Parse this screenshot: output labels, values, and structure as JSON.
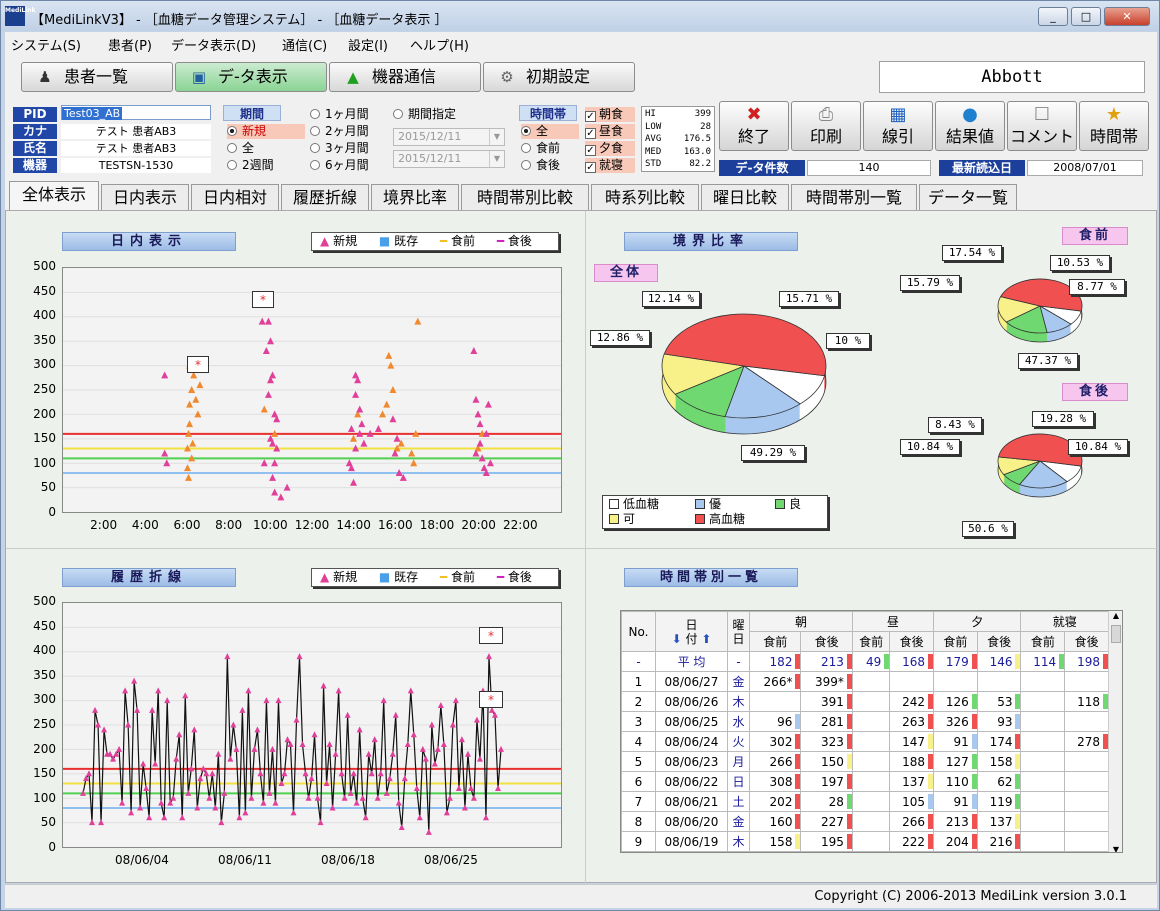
{
  "window": {
    "title": "【MediLinkV3】 - ［血糖データ管理システム］ - ［血糖データ表示 ］",
    "app_icon_text": "MediLink",
    "controls": {
      "minimize": "_",
      "maximize": "□",
      "close": "✕"
    }
  },
  "menu": [
    "システム(S)",
    "患者(P)",
    "データ表示(D)",
    "通信(C)",
    "設定(I)",
    "ヘルプ(H)"
  ],
  "toolbar": {
    "buttons": [
      {
        "label": "患者一覧",
        "icon": "people-icon"
      },
      {
        "label": "デ-タ表示",
        "icon": "window-icon"
      },
      {
        "label": "機器通信",
        "icon": "upload-icon"
      },
      {
        "label": "初期設定",
        "icon": "gear-icon"
      }
    ],
    "device": "Abbott"
  },
  "patient": {
    "labels": {
      "pid": "PID",
      "kana": "カナ",
      "name": "氏名",
      "device": "機器"
    },
    "pid": "Test03_AB",
    "kana": "テスト 患者AB3",
    "name": "テスト 患者AB3",
    "device": "TESTSN-1530"
  },
  "period": {
    "title": "期間",
    "options": [
      "新規",
      "全",
      "2週間",
      "1ヶ月間",
      "2ヶ月間",
      "3ヶ月間",
      "6ヶ月間",
      "期間指定"
    ],
    "selected": "新規",
    "date_from": "2015/12/11",
    "date_to": "2015/12/11"
  },
  "timeslot": {
    "title": "時間帯",
    "radios": [
      "全",
      "食前",
      "食後"
    ],
    "selected": "全",
    "checks": [
      "朝食",
      "昼食",
      "夕食",
      "就寝"
    ],
    "check_mark": "✓"
  },
  "stats": [
    {
      "k": "HI",
      "v": "399"
    },
    {
      "k": "LOW",
      "v": "28"
    },
    {
      "k": "AVG",
      "v": "176.5"
    },
    {
      "k": "MED",
      "v": "163.0"
    },
    {
      "k": "STD",
      "v": "82.2"
    }
  ],
  "actions": [
    {
      "label": "終了",
      "icon": "close-icon",
      "glyph": "✖",
      "color": "#d02020"
    },
    {
      "label": "印刷",
      "icon": "printer-icon",
      "glyph": "⎙",
      "color": "#888888"
    },
    {
      "label": "線引",
      "icon": "line-icon",
      "glyph": "▦",
      "color": "#2060c0"
    },
    {
      "label": "結果値",
      "icon": "pin-icon",
      "glyph": "●",
      "color": "#2080d0"
    },
    {
      "label": "コメント",
      "icon": "comment-icon",
      "glyph": "☐",
      "color": "#888888"
    },
    {
      "label": "時間帯",
      "icon": "star-icon",
      "glyph": "★",
      "color": "#e0a010"
    }
  ],
  "counts": {
    "data_label": "デ-タ件数",
    "data_value": "140",
    "last_label": "最新読込日",
    "last_value": "2008/07/01"
  },
  "tabs": [
    "全体表示",
    "日内表示",
    "日内相対",
    "履歴折線",
    "境界比率",
    "時間帯別比較",
    "時系列比較",
    "曜日比較",
    "時間帯別一覧",
    "データ一覧"
  ],
  "active_tab": "全体表示",
  "legend": {
    "new": "新規",
    "existing": "既存",
    "before": "食前",
    "after": "食後"
  },
  "colors": {
    "pink_point": "#e0409a",
    "orange_point": "#f08a30",
    "red_line": "#e83030",
    "yellow_line": "#f0e040",
    "green_line": "#50d050",
    "blue_line": "#90c0f0",
    "low": "#ffffff",
    "excellent": "#a8c8f0",
    "good": "#70d870",
    "fair": "#f8f088",
    "high": "#f05050"
  },
  "daily": {
    "title": "日内表示",
    "marker": "*",
    "yticks": [
      "500",
      "450",
      "400",
      "350",
      "300",
      "250",
      "200",
      "150",
      "100",
      "50",
      "0"
    ],
    "xticks": [
      "2:00",
      "4:00",
      "6:00",
      "8:00",
      "10:00",
      "12:00",
      "14:00",
      "16:00",
      "18:00",
      "20:00",
      "22:00"
    ]
  },
  "chart_data": [
    {
      "type": "scatter",
      "title": "日内表示",
      "x_unit": "hour of day",
      "ylim": [
        0,
        500
      ],
      "xlim": [
        0,
        24
      ],
      "reference_lines": [
        160,
        130,
        110,
        80
      ],
      "series": [
        {
          "name": "既存",
          "points": [
            [
              6,
              130
            ],
            [
              6.05,
              160
            ],
            [
              6.1,
              220
            ],
            [
              6.2,
              250
            ],
            [
              6.1,
              300
            ],
            [
              6.3,
              280
            ],
            [
              6,
              90
            ],
            [
              6.05,
              70
            ],
            [
              6.2,
              110
            ],
            [
              6.4,
              230
            ],
            [
              6.6,
              260
            ],
            [
              6.5,
              200
            ],
            [
              6.1,
              180
            ],
            [
              6.25,
              140
            ],
            [
              9.7,
              210
            ],
            [
              10.2,
              160
            ],
            [
              14,
              150
            ],
            [
              14.2,
              200
            ],
            [
              15.4,
              200
            ],
            [
              15.6,
              220
            ],
            [
              15.7,
              320
            ],
            [
              15.8,
              300
            ],
            [
              15.9,
              250
            ],
            [
              16.1,
              130
            ],
            [
              16.3,
              140
            ],
            [
              16.8,
              120
            ],
            [
              16.9,
              100
            ],
            [
              17,
              160
            ],
            [
              17.1,
              390
            ],
            [
              20,
              130
            ],
            [
              20.2,
              160
            ]
          ]
        },
        {
          "name": "新規",
          "points": [
            [
              4.9,
              280
            ],
            [
              4.9,
              120
            ],
            [
              5,
              100
            ],
            [
              9.6,
              390
            ],
            [
              9.8,
              330
            ],
            [
              9.9,
              390
            ],
            [
              10,
              350
            ],
            [
              10.1,
              280
            ],
            [
              10,
              270
            ],
            [
              10.2,
              200
            ],
            [
              10.3,
              190
            ],
            [
              10,
              150
            ],
            [
              10.1,
              140
            ],
            [
              10.3,
              130
            ],
            [
              10.2,
              100
            ],
            [
              10.1,
              70
            ],
            [
              10.2,
              40
            ],
            [
              10.5,
              30
            ],
            [
              10.8,
              50
            ],
            [
              9.7,
              100
            ],
            [
              9.9,
              240
            ],
            [
              13.8,
              100
            ],
            [
              13.9,
              90
            ],
            [
              14,
              60
            ],
            [
              14.1,
              130
            ],
            [
              14.3,
              160
            ],
            [
              14.4,
              180
            ],
            [
              14.1,
              240
            ],
            [
              14.2,
              270
            ],
            [
              14.1,
              280
            ],
            [
              14.3,
              210
            ],
            [
              14.5,
              140
            ],
            [
              13.9,
              170
            ],
            [
              14.8,
              160
            ],
            [
              15.2,
              170
            ],
            [
              15.9,
              190
            ],
            [
              16,
              120
            ],
            [
              16.2,
              80
            ],
            [
              16.4,
              70
            ],
            [
              16.1,
              150
            ],
            [
              19.8,
              330
            ],
            [
              19.9,
              230
            ],
            [
              20,
              200
            ],
            [
              20.1,
              180
            ],
            [
              20.2,
              110
            ],
            [
              20.3,
              90
            ],
            [
              20.5,
              220
            ],
            [
              20.4,
              160
            ],
            [
              20.1,
              140
            ],
            [
              19.9,
              120
            ],
            [
              20.6,
              100
            ],
            [
              20.4,
              80
            ]
          ]
        }
      ]
    },
    {
      "type": "pie",
      "title": "全体",
      "categories": [
        "低血糖",
        "優",
        "良",
        "可",
        "高血糖"
      ],
      "values": [
        10,
        15.71,
        12.14,
        12.86,
        49.29
      ]
    },
    {
      "type": "pie",
      "title": "食前",
      "categories": [
        "低血糖",
        "優",
        "良",
        "可",
        "高血糖"
      ],
      "values": [
        8.77,
        10.53,
        17.54,
        15.79,
        47.37
      ]
    },
    {
      "type": "pie",
      "title": "食後",
      "categories": [
        "低血糖",
        "優",
        "良",
        "可",
        "高血糖"
      ],
      "values": [
        10.84,
        19.28,
        8.43,
        10.84,
        50.6
      ]
    },
    {
      "type": "line",
      "title": "履歴折線",
      "ylim": [
        0,
        500
      ],
      "reference_lines": [
        160,
        130,
        110,
        80
      ],
      "x_ticks": [
        "08/06/04",
        "08/06/11",
        "08/06/18",
        "08/06/25"
      ],
      "values": [
        110,
        140,
        150,
        50,
        280,
        250,
        50,
        240,
        190,
        190,
        180,
        190,
        200,
        90,
        320,
        250,
        70,
        340,
        280,
        80,
        170,
        120,
        60,
        280,
        170,
        320,
        90,
        60,
        300,
        90,
        100,
        180,
        230,
        60,
        310,
        110,
        160,
        240,
        80,
        140,
        160,
        150,
        100,
        150,
        80,
        190,
        50,
        110,
        390,
        180,
        250,
        200,
        60,
        280,
        70,
        320,
        100,
        200,
        240,
        150,
        90,
        300,
        110,
        200,
        90,
        300,
        130,
        150,
        220,
        210,
        70,
        260,
        390,
        210,
        150,
        100,
        140,
        230,
        100,
        50,
        330,
        130,
        210,
        80,
        190,
        320,
        150,
        100,
        270,
        110,
        150,
        90,
        240,
        100,
        60,
        190,
        150,
        220,
        100,
        150,
        300,
        110,
        140,
        190,
        270,
        90,
        40,
        140,
        210,
        320,
        230,
        120,
        60,
        200,
        180,
        30,
        250,
        170,
        200,
        290,
        210,
        70,
        100,
        250,
        300,
        120,
        220,
        80,
        190,
        120,
        100,
        260,
        180,
        320,
        60,
        390,
        280,
        270,
        120,
        200
      ]
    }
  ],
  "history": {
    "title": "履歴折線",
    "yticks": [
      "500",
      "450",
      "400",
      "350",
      "300",
      "250",
      "200",
      "150",
      "100",
      "50",
      "0"
    ],
    "xticks": [
      "08/06/04",
      "08/06/11",
      "08/06/18",
      "08/06/25"
    ],
    "marker": "*"
  },
  "boundary": {
    "title": "境界比率",
    "total_title": "全体",
    "before_title": "食前",
    "after_title": "食後",
    "total_labels": [
      "10 %",
      "15.71 %",
      "12.14 %",
      "12.86 %",
      "49.29 %"
    ],
    "before_labels": [
      "8.77 %",
      "10.53 %",
      "17.54 %",
      "15.79 %",
      "47.37 %"
    ],
    "after_labels": [
      "10.84 %",
      "19.28 %",
      "8.43 %",
      "10.84 %",
      "50.6 %"
    ],
    "legend": [
      "低血糖",
      "優",
      "良",
      "可",
      "高血糖"
    ]
  },
  "timetable": {
    "title": "時間帯別一覧",
    "col_no": "No.",
    "col_date_top": "日",
    "col_date_bottom": "付",
    "col_dow_top": "曜",
    "col_dow_bottom": "日",
    "groups": [
      "朝",
      "昼",
      "夕",
      "就寝"
    ],
    "sub": [
      "食前",
      "食後"
    ],
    "avg": {
      "no": "-",
      "label": "平 均",
      "dow": "-",
      "vals": [
        "182",
        "213",
        "49",
        "168",
        "179",
        "146",
        "114",
        "198"
      ]
    },
    "rows": [
      {
        "no": "1",
        "date": "08/06/27",
        "dow": "金",
        "vals": [
          "266*",
          "399*",
          "",
          "",
          "",
          "",
          "",
          ""
        ]
      },
      {
        "no": "2",
        "date": "08/06/26",
        "dow": "木",
        "vals": [
          "",
          "391",
          "",
          "242",
          "126",
          "53",
          "",
          "118"
        ]
      },
      {
        "no": "3",
        "date": "08/06/25",
        "dow": "水",
        "vals": [
          "96",
          "281",
          "",
          "263",
          "326",
          "93",
          "",
          ""
        ]
      },
      {
        "no": "4",
        "date": "08/06/24",
        "dow": "火",
        "vals": [
          "302",
          "323",
          "",
          "147",
          "91",
          "174",
          "",
          "278"
        ]
      },
      {
        "no": "5",
        "date": "08/06/23",
        "dow": "月",
        "vals": [
          "266",
          "150",
          "",
          "188",
          "127",
          "158",
          "",
          ""
        ]
      },
      {
        "no": "6",
        "date": "08/06/22",
        "dow": "日",
        "vals": [
          "308",
          "197",
          "",
          "137",
          "110",
          "62",
          "",
          ""
        ]
      },
      {
        "no": "7",
        "date": "08/06/21",
        "dow": "土",
        "vals": [
          "202",
          "28",
          "",
          "105",
          "91",
          "119",
          "",
          ""
        ]
      },
      {
        "no": "8",
        "date": "08/06/20",
        "dow": "金",
        "vals": [
          "160",
          "227",
          "",
          "266",
          "213",
          "137",
          "",
          ""
        ]
      },
      {
        "no": "9",
        "date": "08/06/19",
        "dow": "木",
        "vals": [
          "158",
          "195",
          "",
          "222",
          "204",
          "216",
          "",
          ""
        ]
      }
    ]
  },
  "status": {
    "copyright": "Copyright (C) 2006-2013 MediLink version 3.0.1"
  }
}
